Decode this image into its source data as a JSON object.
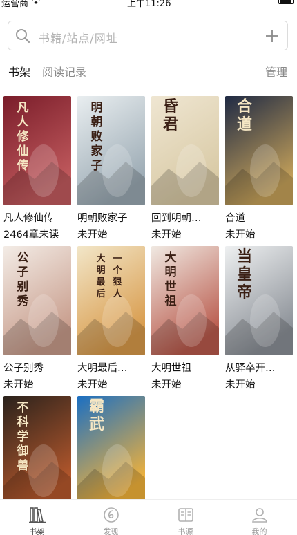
{
  "status_bar": {
    "carrier": "运营商",
    "time": "上午11:26"
  },
  "search": {
    "placeholder": "书籍/站点/网址"
  },
  "header": {
    "tab_shelf": "书架",
    "tab_history": "阅读记录",
    "manage": "管理"
  },
  "books": [
    {
      "title": "凡人修仙传",
      "status": "2464章未读",
      "cover_text": "凡人修仙传",
      "cover_colors": [
        "#7a1d2a",
        "#c25b5e"
      ]
    },
    {
      "title": "明朝败家子",
      "status": "未开始",
      "cover_text": "明朝败家子",
      "cover_colors": [
        "#e9eef0",
        "#9aa9b3"
      ]
    },
    {
      "title": "回到明朝…",
      "status": "未开始",
      "cover_text": "昏君",
      "cover_colors": [
        "#efe6d2",
        "#d8c9a4"
      ]
    },
    {
      "title": "合道",
      "status": "未开始",
      "cover_text": "合道",
      "cover_colors": [
        "#1f2a44",
        "#c6a25a"
      ]
    },
    {
      "title": "公子别秀",
      "status": "未开始",
      "cover_text": "公子别秀",
      "cover_colors": [
        "#f3ece6",
        "#c79b8a"
      ]
    },
    {
      "title": "大明最后…",
      "status": "未开始",
      "cover_text": "大明最后一个狠人",
      "cover_colors": [
        "#f2e6c8",
        "#d89a4a"
      ]
    },
    {
      "title": "大明世祖",
      "status": "未开始",
      "cover_text": "大明世祖",
      "cover_colors": [
        "#f0e9e2",
        "#b95a4c"
      ]
    },
    {
      "title": "从驿卒开…",
      "status": "未开始",
      "cover_text": "当皇帝",
      "cover_colors": [
        "#eef0f1",
        "#8a8f96"
      ]
    },
    {
      "title": "",
      "status": "",
      "cover_text": "不科学御兽",
      "cover_colors": [
        "#2a221c",
        "#b6582c"
      ]
    },
    {
      "title": "",
      "status": "",
      "cover_text": "霸武",
      "cover_colors": [
        "#1b6fc2",
        "#f2b23a"
      ]
    }
  ],
  "tab_bar": [
    {
      "label": "书架",
      "icon": "bookshelf-icon",
      "active": true
    },
    {
      "label": "发现",
      "icon": "discover-icon",
      "active": false
    },
    {
      "label": "书源",
      "icon": "book-source-icon",
      "active": false
    },
    {
      "label": "我的",
      "icon": "profile-icon",
      "active": false
    }
  ],
  "colors": {
    "accent": "#111111",
    "muted": "#8a8a8a",
    "tab_inactive": "#9a9a9a"
  }
}
